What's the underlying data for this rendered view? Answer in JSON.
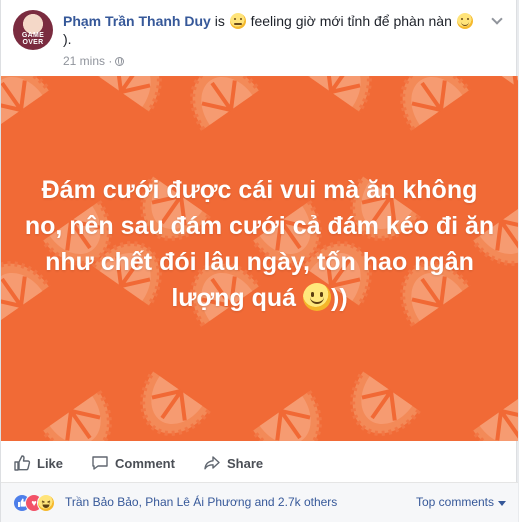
{
  "post": {
    "author": "Phạm Trần Thanh Duy",
    "is_text": " is ",
    "feeling_text": " feeling giờ mới tỉnh để phàn nàn ",
    "feeling_end": ").",
    "timestamp": "21 mins ·",
    "avatar_badge_1": "GAME",
    "avatar_badge_2": "OVER"
  },
  "banner": {
    "text": "Đám cưới được cái vui mà ăn không no, nên sau đám cưới cả đám kéo đi ăn như chết đói lâu ngày, tốn hao ngân lượng quá ",
    "text_end": "))",
    "background_color": "#f16a36"
  },
  "actions": {
    "like": "Like",
    "comment": "Comment",
    "share": "Share"
  },
  "footer": {
    "reaction_names": "Trần Bảo Bảo, Phan Lê Ái Phương and 2.7k others",
    "top_comments": "Top comments",
    "reaction_icons": [
      "like-icon",
      "love-icon",
      "haha-icon"
    ]
  }
}
